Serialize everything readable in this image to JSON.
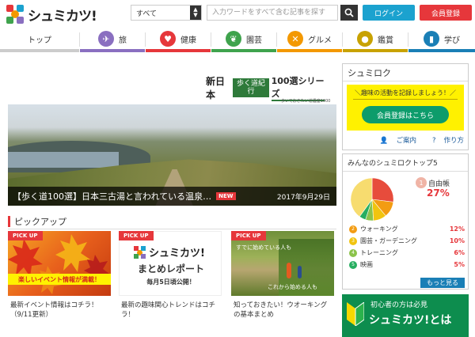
{
  "header": {
    "logo_text": "シュミカツ!",
    "search_category": "すべて",
    "search_placeholder": "入力ワードをすべて含む記事を探す",
    "login_label": "ログイン",
    "register_label": "会員登録"
  },
  "nav": {
    "items": [
      {
        "label": "トップ",
        "color": "#cccccc"
      },
      {
        "label": "旅",
        "color": "#8a6fc0"
      },
      {
        "label": "健康",
        "color": "#e6373b"
      },
      {
        "label": "園芸",
        "color": "#3fa34d"
      },
      {
        "label": "グルメ",
        "color": "#f39800"
      },
      {
        "label": "鑑賞",
        "color": "#c8a200"
      },
      {
        "label": "学び",
        "color": "#1a7fb6"
      }
    ]
  },
  "hero": {
    "series_a": "新日本",
    "series_b": "歩く道紀行",
    "series_c": "100選シリーズ",
    "series_sub": "歩いておきたい道遺産1000",
    "caption": "【歩く道100選】日本三古湯と言われている温泉…",
    "new_badge": "NEW",
    "date": "2017年9月29日"
  },
  "pickup": {
    "title": "ピックアップ",
    "badge": "PICK UP",
    "cards": [
      {
        "banner": "楽しいイベント情報が満載！",
        "text": "最新イベント情報はコチラ！（9/11更新）"
      },
      {
        "logo": "シュミカツ!",
        "line1": "まとめレポート",
        "line2": "毎月5日頃公開！",
        "text": "最新の趣味関心トレンドはコチラ！"
      },
      {
        "top": "すでに始めている人も",
        "bottom": "これから始める人も",
        "text": "知っておきたい！ウオーキングの基本まとめ"
      }
    ]
  },
  "shumiroku": {
    "title": "シュミロク",
    "message": "＼趣味の活動を記録しましょう！／",
    "register_button": "会員登録はこちら",
    "guide_link": "ご案内",
    "howto_link": "作り方"
  },
  "top5": {
    "title": "みんなのシュミロクトップ5",
    "items": [
      {
        "rank": "1",
        "name": "自由帳",
        "pct": "27%",
        "value": 27,
        "color": "#e74c3c"
      },
      {
        "rank": "2",
        "name": "ウォーキング",
        "pct": "12%",
        "value": 12,
        "color": "#f39c12"
      },
      {
        "rank": "3",
        "name": "園芸・ガーデニング",
        "pct": "10%",
        "value": 10,
        "color": "#f1c40f"
      },
      {
        "rank": "4",
        "name": "トレーニング",
        "pct": "6%",
        "value": 6,
        "color": "#8bc34a"
      },
      {
        "rank": "5",
        "name": "映画",
        "pct": "5%",
        "value": 5,
        "color": "#27ae60"
      }
    ],
    "other_color": "#f7dc6f",
    "more_label": "もっと見る"
  },
  "beginner": {
    "line1": "初心者の方は必見",
    "line2": "シュミカツ!とは"
  }
}
